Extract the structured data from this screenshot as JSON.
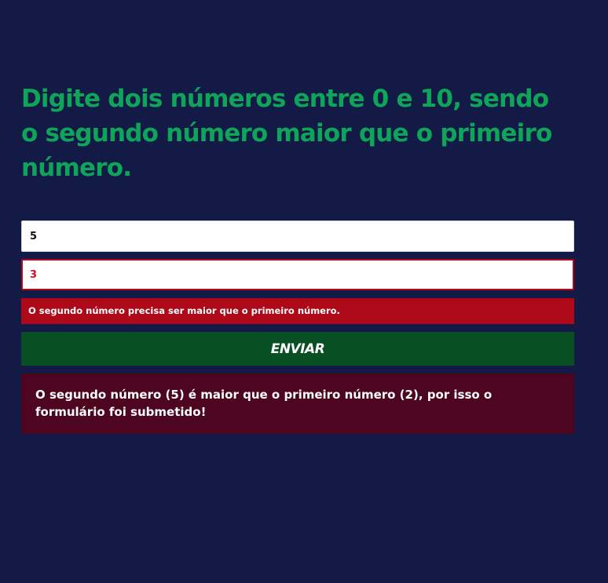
{
  "heading": "Digite dois números entre 0 e 10, sendo o segundo número maior que o primeiro número.",
  "form": {
    "first_number_value": "5",
    "second_number_value": "3",
    "validation_error": "O segundo número precisa ser maior que o primeiro número.",
    "submit_label": "ENVIAR"
  },
  "result_message": "O segundo número (5) é maior que o primeiro número (2), por isso o formulário foi submetido!",
  "colors": {
    "background": "#121a45",
    "heading": "#0ea45a",
    "error": "#ad0918",
    "submit": "#075023",
    "result": "#4d0520"
  }
}
